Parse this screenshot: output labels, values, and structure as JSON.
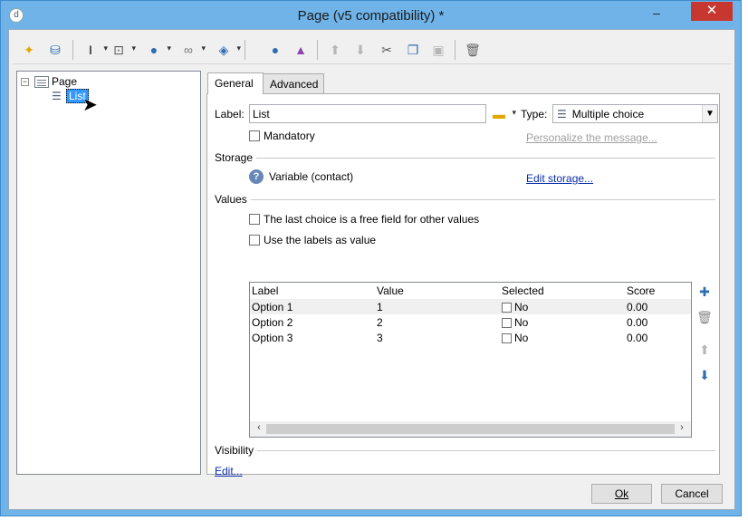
{
  "window": {
    "title": "Page (v5 compatibility) *",
    "minimize": "–",
    "close": "✕",
    "app_icon": "d"
  },
  "toolbar": {
    "icons": [
      "magic-wand-icon",
      "database-user-icon",
      "text-cursor-icon",
      "form-input-icon",
      "globe-icon",
      "link-icon",
      "cube-icon",
      "person-icon",
      "shapes-icon",
      "arrow-up-icon",
      "arrow-down-icon",
      "scissors-icon",
      "copy-icon",
      "paste-icon",
      "trash-icon"
    ]
  },
  "tree": {
    "root": {
      "label": "Page",
      "expander": "−"
    },
    "child": {
      "label": "List"
    }
  },
  "tabs": [
    {
      "label": "General",
      "active": true
    },
    {
      "label": "Advanced",
      "active": false
    }
  ],
  "general": {
    "label_caption": "Label:",
    "label_value": "List",
    "type_caption": "Type:",
    "type_value": "Multiple choice",
    "mandatory": "Mandatory",
    "personalize_link": "Personalize the message...",
    "storage_title": "Storage",
    "storage_value": "Variable (contact)",
    "edit_storage_link": "Edit storage...",
    "values_title": "Values",
    "free_field_option": "The last choice is a free field for other values",
    "use_labels_option": "Use the labels as value",
    "visibility_title": "Visibility",
    "edit_link": "Edit..."
  },
  "table": {
    "headers": [
      "Label",
      "Value",
      "Selected",
      "Score"
    ],
    "rows": [
      {
        "label": "Option 1",
        "value": "1",
        "selected": "No",
        "score": "0.00"
      },
      {
        "label": "Option 2",
        "value": "2",
        "selected": "No",
        "score": "0.00"
      },
      {
        "label": "Option 3",
        "value": "3",
        "selected": "No",
        "score": "0.00"
      }
    ]
  },
  "buttons": {
    "ok": "Ok",
    "cancel": "Cancel"
  },
  "colors": {
    "title_bg": "#6fb3e8",
    "close_bg": "#c7372f",
    "selection": "#3399ff",
    "link": "#0b2ea8"
  }
}
